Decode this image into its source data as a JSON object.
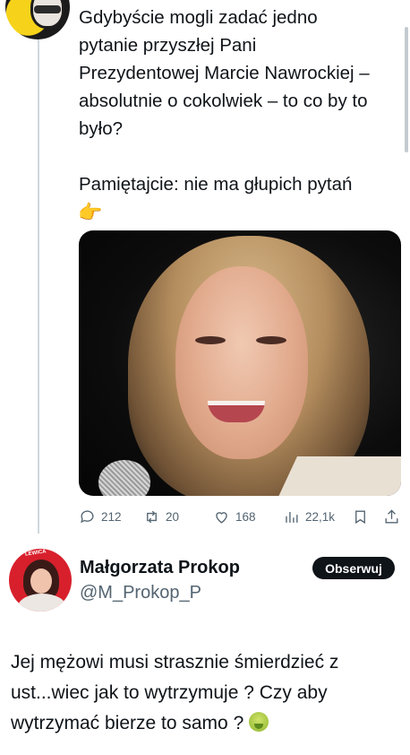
{
  "thread": {
    "tweet_lines": [
      "Gdybyście mogli zadać jedno",
      "pytanie przyszłej Pani",
      "Prezydentowej Marcie Nawrockiej –",
      "absolutnie o cokolwiek – to co by to",
      "było?"
    ],
    "tweet_line2": "Pamiętajcie: nie ma głupich pytań",
    "emoji_point": "👈",
    "metrics": {
      "replies": "212",
      "retweets": "20",
      "likes": "168",
      "views": "22,1k"
    }
  },
  "reply": {
    "author_name": "Małgorzata Prokop",
    "handle": "@M_Prokop_P",
    "follow_label": "Obserwuj",
    "avatar_tag": "LEWICA",
    "text_lines": [
      "Jej mężowi musi strasznie śmierdzieć z",
      "ust...wiec jak to wytrzymuje ? Czy aby",
      "wytrzymać bierze to samo ?"
    ]
  }
}
